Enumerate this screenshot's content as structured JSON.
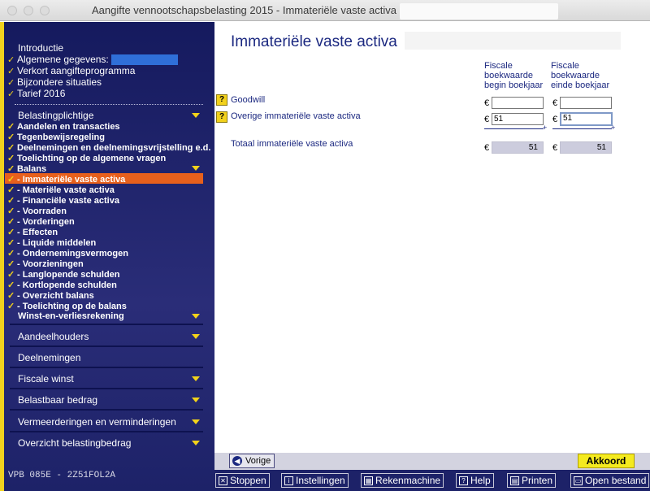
{
  "window": {
    "title": "Aangifte vennootschapsbelasting 2015 - Immateriële vaste activa"
  },
  "sidebar": {
    "top_items": [
      {
        "label": "Introductie",
        "checked": false
      },
      {
        "label": "Algemene gegevens:",
        "checked": true
      },
      {
        "label": "Verkort aangifteprogramma",
        "checked": true
      },
      {
        "label": "Bijzondere situaties",
        "checked": true
      },
      {
        "label": "Tarief 2016",
        "checked": true
      }
    ],
    "belasting_header": "Belastingplichtige",
    "belasting_items": [
      "Aandelen en transacties",
      "Tegenbewijsregeling",
      "Deelnemingen en deelnemingsvrijstelling e.d.",
      "Toelichting op de algemene vragen",
      "Balans"
    ],
    "balans_items": [
      "- Immateriële vaste activa",
      "- Materiële vaste activa",
      "- Financiële vaste activa",
      "- Voorraden",
      "- Vorderingen",
      "- Effecten",
      "- Liquide middelen",
      "- Ondernemingsvermogen",
      "- Voorzieningen",
      "- Langlopende schulden",
      "- Kortlopende schulden",
      "- Overzicht balans",
      "- Toelichting op de balans"
    ],
    "winst_item": "Winst-en-verliesrekening",
    "sections": [
      {
        "label": "Aandeelhouders",
        "expand": true
      },
      {
        "label": "Deelnemingen",
        "expand": false
      },
      {
        "label": "Fiscale winst",
        "expand": true
      },
      {
        "label": "Belastbaar bedrag",
        "expand": true
      },
      {
        "label": "Vermeerderingen en verminderingen",
        "expand": true
      },
      {
        "label": "Overzicht belastingbedrag",
        "expand": true
      }
    ],
    "footer": "VPB 085E - 2Z51FOL2A"
  },
  "main": {
    "title": "Immateriële vaste activa",
    "col_begin": [
      "Fiscale",
      "boekwaarde",
      "begin boekjaar"
    ],
    "col_end": [
      "Fiscale",
      "boekwaarde",
      "einde boekjaar"
    ],
    "help_label": "?",
    "currency": "€",
    "rows": [
      {
        "label": "Goodwill",
        "begin": "",
        "end": ""
      },
      {
        "label": "Overige immateriële vaste activa",
        "begin": "51",
        "end": "51"
      }
    ],
    "total": {
      "label": "Totaal immateriële vaste activa",
      "begin": "51",
      "end": "51"
    },
    "plus": "+"
  },
  "nav": {
    "prev": "Vorige",
    "ok": "Akkoord"
  },
  "toolbar": {
    "stoppen": "Stoppen",
    "instellingen": "Instellingen",
    "rekenmachine": "Rekenmachine",
    "help": "Help",
    "printen": "Printen",
    "open": "Open bestand"
  },
  "colors": {
    "sidebar": "#1d2268",
    "accent_yellow": "#f3d31a",
    "highlight": "#e7601c",
    "title_blue": "#1b2880"
  }
}
